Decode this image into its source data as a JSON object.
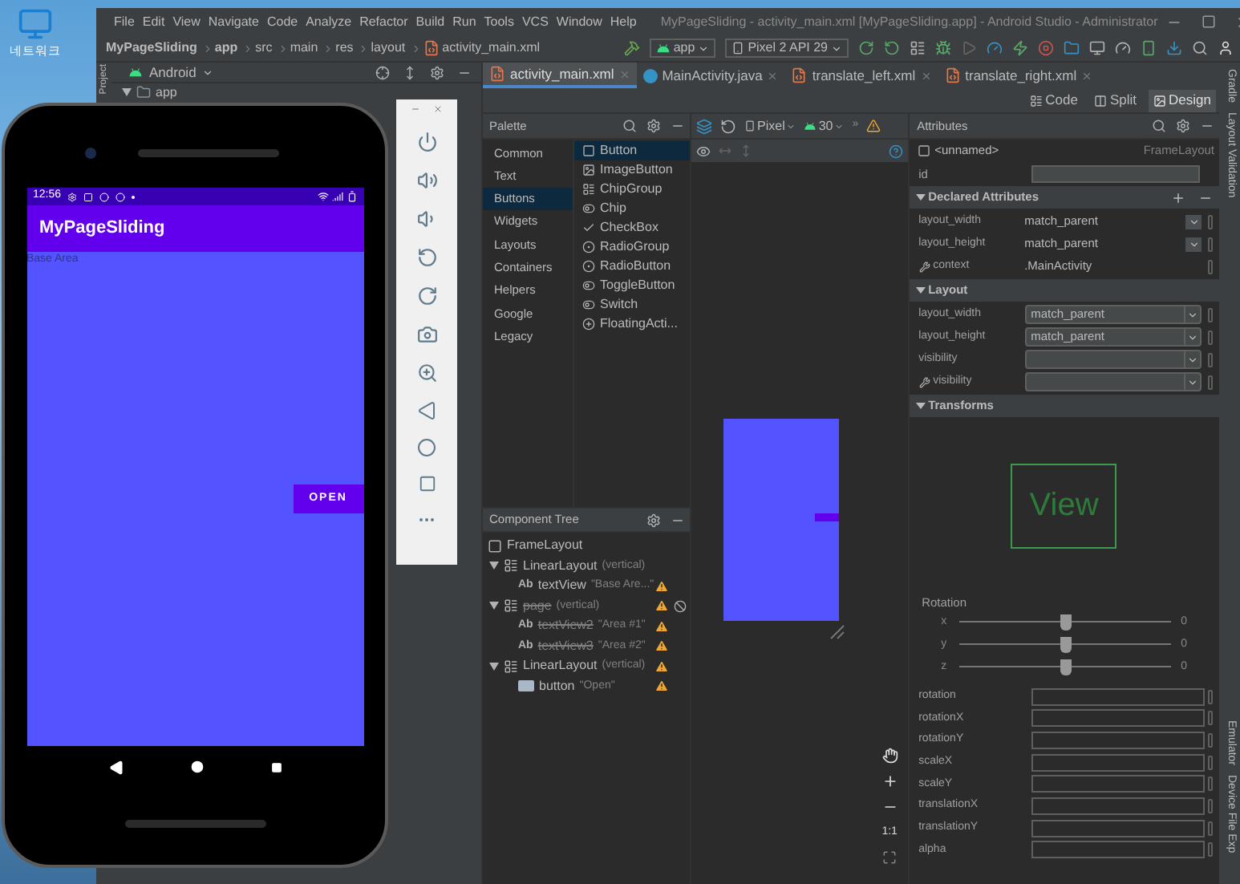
{
  "desktop": {
    "icons": [
      {
        "label": "네트워크"
      }
    ]
  },
  "ide": {
    "title": "MyPageSliding - activity_main.xml [MyPageSliding.app] - Android Studio - Administrator",
    "menu": [
      "File",
      "Edit",
      "View",
      "Navigate",
      "Code",
      "Analyze",
      "Refactor",
      "Build",
      "Run",
      "Tools",
      "VCS",
      "Window",
      "Help"
    ],
    "breadcrumb": [
      {
        "label": "MyPageSliding",
        "kind": "project"
      },
      {
        "label": "app",
        "kind": "project"
      },
      {
        "label": "src",
        "kind": "folder"
      },
      {
        "label": "main",
        "kind": "folder"
      },
      {
        "label": "res",
        "kind": "folder"
      },
      {
        "label": "layout",
        "kind": "folder"
      },
      {
        "label": "activity_main.xml",
        "kind": "xml"
      }
    ],
    "run_config": "app",
    "device": "Pixel 2 API 29",
    "project_panel": {
      "side_label": "Project",
      "view": "Android",
      "tree": [
        {
          "label": "app",
          "expanded": true
        }
      ]
    },
    "editor_tabs": [
      {
        "label": "activity_main.xml",
        "selected": true,
        "kind": "xml"
      },
      {
        "label": "MainActivity.java",
        "selected": false,
        "kind": "java"
      },
      {
        "label": "translate_left.xml",
        "selected": false,
        "kind": "xml"
      },
      {
        "label": "translate_right.xml",
        "selected": false,
        "kind": "xml"
      }
    ],
    "view_modes": [
      {
        "label": "Code",
        "selected": false
      },
      {
        "label": "Split",
        "selected": false
      },
      {
        "label": "Design",
        "selected": true
      }
    ],
    "palette": {
      "title": "Palette",
      "categories": [
        {
          "label": "Common",
          "selected": false
        },
        {
          "label": "Text",
          "selected": false
        },
        {
          "label": "Buttons",
          "selected": true
        },
        {
          "label": "Widgets",
          "selected": false
        },
        {
          "label": "Layouts",
          "selected": false
        },
        {
          "label": "Containers",
          "selected": false
        },
        {
          "label": "Helpers",
          "selected": false
        },
        {
          "label": "Google",
          "selected": false
        },
        {
          "label": "Legacy",
          "selected": false
        }
      ],
      "items": [
        {
          "label": "Button",
          "selected": true,
          "kind": "button"
        },
        {
          "label": "ImageButton",
          "selected": false,
          "kind": "image"
        },
        {
          "label": "ChipGroup",
          "selected": false,
          "kind": "chipgroup"
        },
        {
          "label": "Chip",
          "selected": false,
          "kind": "chip"
        },
        {
          "label": "CheckBox",
          "selected": false,
          "kind": "check"
        },
        {
          "label": "RadioGroup",
          "selected": false,
          "kind": "radio"
        },
        {
          "label": "RadioButton",
          "selected": false,
          "kind": "radio"
        },
        {
          "label": "ToggleButton",
          "selected": false,
          "kind": "toggle"
        },
        {
          "label": "Switch",
          "selected": false,
          "kind": "switch"
        },
        {
          "label": "FloatingActi...",
          "selected": false,
          "kind": "fab"
        }
      ]
    },
    "canvas_toolbar": {
      "device": "Pixel",
      "api": "30",
      "overflow": "»"
    },
    "component_tree": {
      "title": "Component Tree",
      "nodes": [
        {
          "label": "FrameLayout",
          "kind": "frame",
          "warning": false,
          "hidden": false,
          "children": [
            {
              "label": "LinearLayout",
              "detail": "(vertical)",
              "kind": "layout",
              "expanded": true,
              "warning": false,
              "hidden": false,
              "children": [
                {
                  "label": "textView",
                  "detail": "\"Base Are...\"",
                  "kind": "text",
                  "glyph": "Ab",
                  "warning": true,
                  "hidden": false
                }
              ]
            },
            {
              "label": "page",
              "detail": "(vertical)",
              "kind": "layout",
              "expanded": true,
              "warning": true,
              "hidden": true,
              "visibility_flag": true,
              "children": [
                {
                  "label": "textView2",
                  "detail": "\"Area #1\"",
                  "kind": "text",
                  "glyph": "Ab",
                  "warning": true,
                  "hidden": true
                },
                {
                  "label": "textView3",
                  "detail": "\"Area #2\"",
                  "kind": "text",
                  "glyph": "Ab",
                  "warning": true,
                  "hidden": true
                }
              ]
            },
            {
              "label": "LinearLayout",
              "detail": "(vertical)",
              "kind": "layout",
              "expanded": true,
              "warning": true,
              "hidden": false,
              "children": [
                {
                  "label": "button",
                  "detail": "\"Open\"",
                  "kind": "button",
                  "warning": true,
                  "hidden": false
                }
              ]
            }
          ]
        }
      ]
    },
    "zoom_label": "1:1",
    "attributes": {
      "title": "Attributes",
      "element_name": "<unnamed>",
      "element_type": "FrameLayout",
      "id_label": "id",
      "sections": [
        {
          "title": "Declared Attributes",
          "expanded": true,
          "rows": [
            {
              "label": "layout_width",
              "value": "match_parent",
              "kind": "combo",
              "tool": false
            },
            {
              "label": "layout_height",
              "value": "match_parent",
              "kind": "combo",
              "tool": false
            },
            {
              "label": "context",
              "value": ".MainActivity",
              "kind": "text",
              "tool": true
            }
          ]
        },
        {
          "title": "Layout",
          "expanded": true,
          "rows": [
            {
              "label": "layout_width",
              "value": "match_parent",
              "kind": "dropdown",
              "tool": false
            },
            {
              "label": "layout_height",
              "value": "match_parent",
              "kind": "dropdown",
              "tool": false
            },
            {
              "label": "visibility",
              "kind": "dropdown",
              "tool": false
            },
            {
              "label": "visibility",
              "kind": "dropdown",
              "tool": true
            }
          ]
        }
      ],
      "transforms": {
        "title": "Transforms",
        "expanded": true,
        "preview": "View",
        "rotation_label": "Rotation",
        "axes": [
          {
            "label": "x",
            "level": 0.5,
            "reading": "0"
          },
          {
            "label": "y",
            "level": 0.5,
            "reading": "0"
          },
          {
            "label": "z",
            "level": 0.5,
            "reading": "0"
          }
        ],
        "rows": [
          "rotation",
          "rotationX",
          "rotationY",
          "scaleX",
          "scaleY",
          "translationX",
          "translationY",
          "alpha"
        ]
      }
    },
    "side_tabs": [
      "Gradle",
      "Layout Validation",
      "Emulator",
      "Device File Exp"
    ]
  },
  "emulator": {
    "time": "12:56",
    "app_title": "MyPageSliding",
    "base_text": "Base Area",
    "button": "OPEN"
  }
}
